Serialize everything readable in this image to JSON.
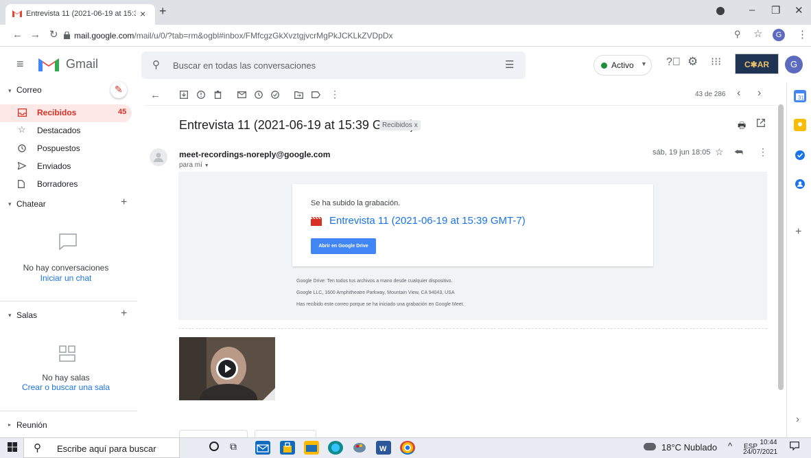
{
  "browser": {
    "tab_title": "Entrevista 11 (2021-06-19 at 15:3",
    "tab_close": "×",
    "new_tab": "+",
    "url_host": "mail.google.com",
    "url_path": "/mail/u/0/?tab=rm&ogbl#inbox/FMfcgzGkXvztgjvcrMgPkJCKLkZVDpDx"
  },
  "gmail": {
    "brand": "Gmail",
    "search_placeholder": "Buscar en todas las conversaciones",
    "status": "Activo",
    "account_logo": "C✱AR",
    "avatar_letter": "G"
  },
  "sidebar": {
    "mail_section": "Correo",
    "items": [
      {
        "label": "Recibidos",
        "count": "45",
        "icon": "inbox-icon"
      },
      {
        "label": "Destacados",
        "icon": "star-icon"
      },
      {
        "label": "Pospuestos",
        "icon": "clock-icon"
      },
      {
        "label": "Enviados",
        "icon": "send-icon"
      },
      {
        "label": "Borradores",
        "icon": "draft-icon"
      }
    ],
    "chat_section": "Chatear",
    "chat_empty": "No hay conversaciones",
    "chat_link": "Iniciar un chat",
    "rooms_section": "Salas",
    "rooms_empty": "No hay salas",
    "rooms_link": "Crear o buscar una sala",
    "meeting_section": "Reunión"
  },
  "toolbar": {
    "pagination": "43 de 286"
  },
  "message": {
    "subject": "Entrevista 11 (2021-06-19 at 15:39 GMT-7)",
    "label_chip": "Recibidos x",
    "sender": "meet-recordings-noreply@google.com",
    "to": "para mí",
    "date": "sáb, 19 jun 18:05",
    "card_notice": "Se ha subido la grabación.",
    "card_link": "Entrevista 11 (2021-06-19 at 15:39 GMT-7)",
    "drive_button": "Abrir en Google Drive",
    "footer_1": "Google Drive: Ten todos tus archivos a mano desde cualquier dispositivo.",
    "footer_2": "Google LLC, 1600 Amphitheatre Parkway, Mountain View, CA 94043, USA",
    "footer_3": "Has recibido este correo porque se ha iniciado una grabación en Google Meet."
  },
  "taskbar": {
    "search_placeholder": "Escribe aquí para buscar",
    "weather": "18°C  Nublado",
    "language": "ESP",
    "time": "10:44",
    "date": "24/07/2021"
  }
}
